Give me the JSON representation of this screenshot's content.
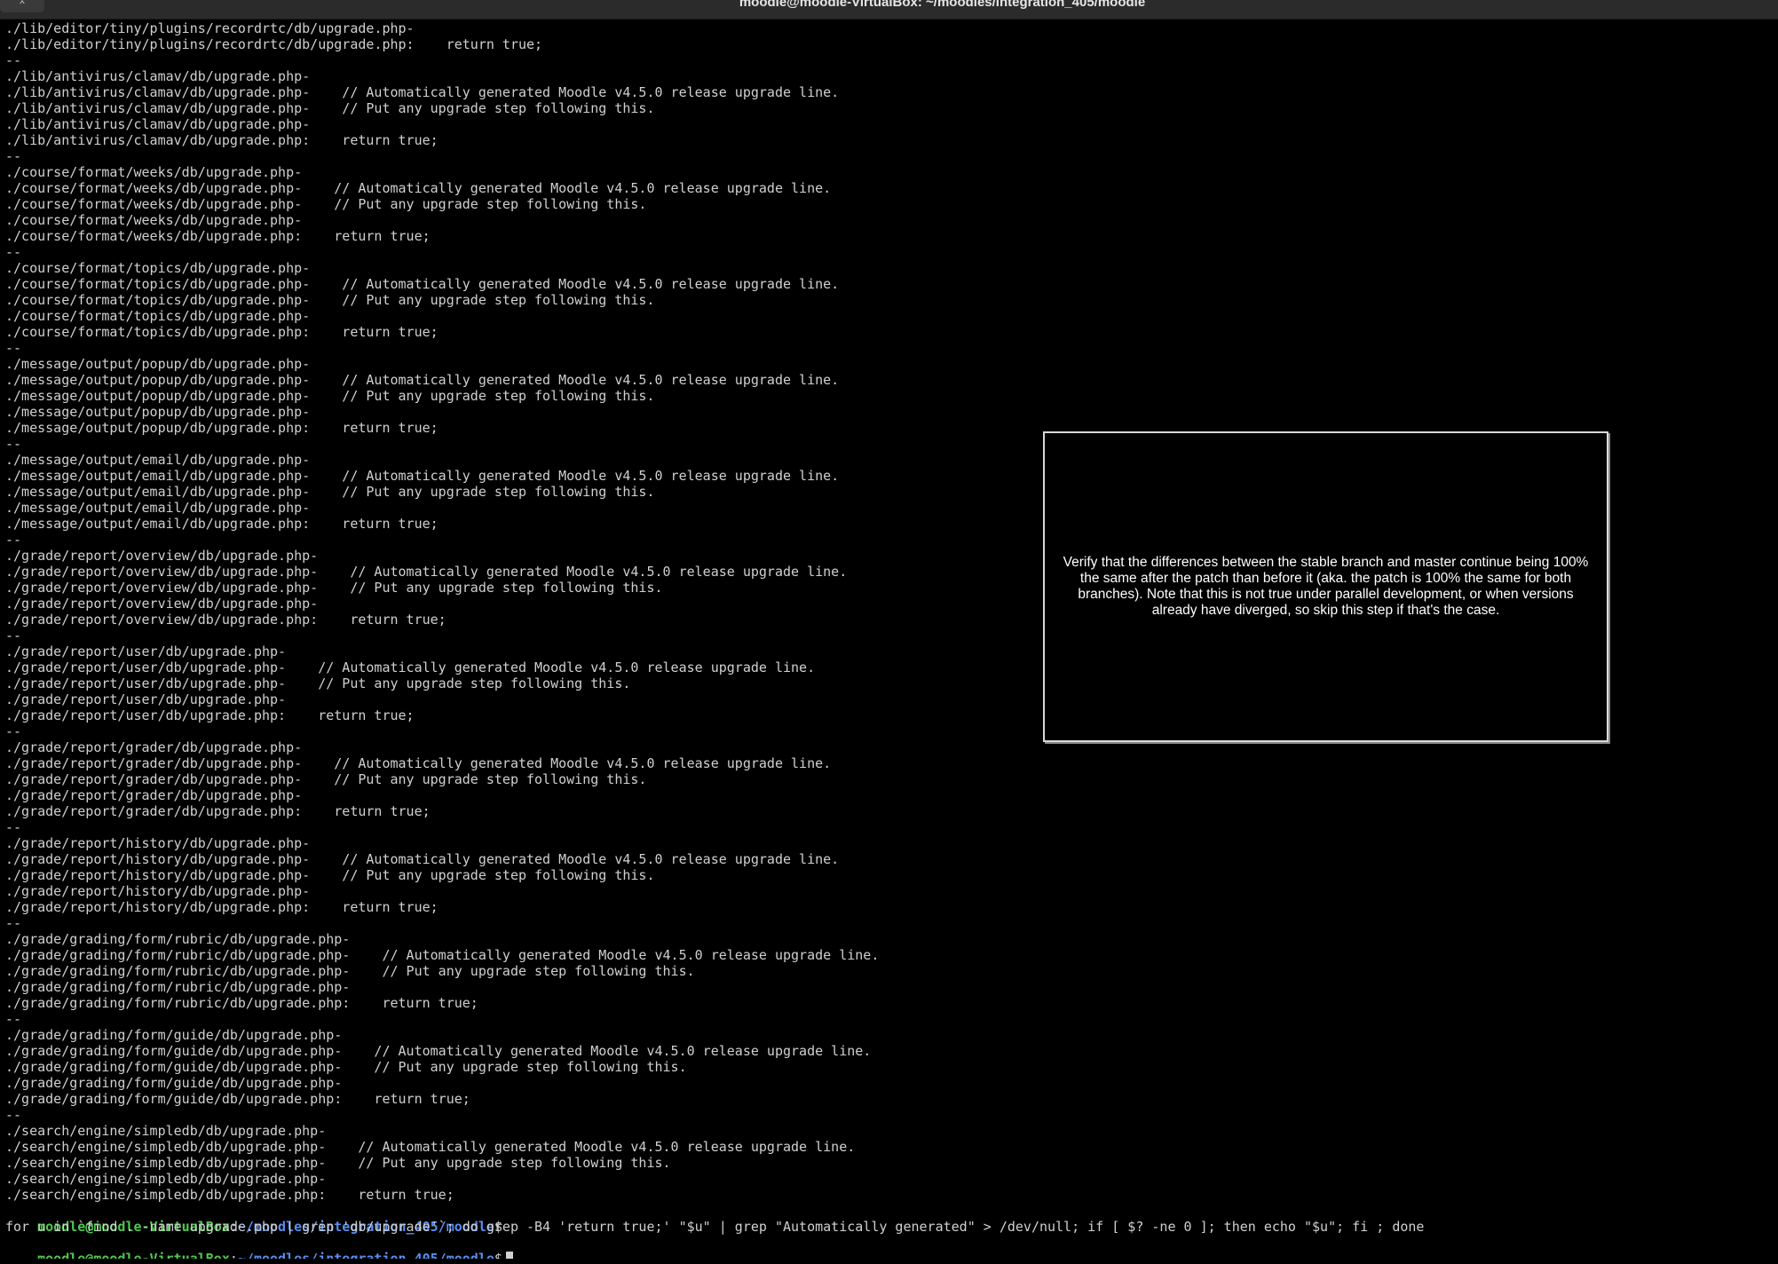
{
  "window": {
    "title": "moodle@moodle-VirtualBox: ~/moodles/integration_405/moodle",
    "menu_glyph": "⌃"
  },
  "terminal": {
    "lines": [
      "./lib/editor/tiny/plugins/recordrtc/db/upgrade.php-",
      "./lib/editor/tiny/plugins/recordrtc/db/upgrade.php:    return true;",
      "--",
      "./lib/antivirus/clamav/db/upgrade.php-",
      "./lib/antivirus/clamav/db/upgrade.php-    // Automatically generated Moodle v4.5.0 release upgrade line.",
      "./lib/antivirus/clamav/db/upgrade.php-    // Put any upgrade step following this.",
      "./lib/antivirus/clamav/db/upgrade.php-",
      "./lib/antivirus/clamav/db/upgrade.php:    return true;",
      "--",
      "./course/format/weeks/db/upgrade.php-",
      "./course/format/weeks/db/upgrade.php-    // Automatically generated Moodle v4.5.0 release upgrade line.",
      "./course/format/weeks/db/upgrade.php-    // Put any upgrade step following this.",
      "./course/format/weeks/db/upgrade.php-",
      "./course/format/weeks/db/upgrade.php:    return true;",
      "--",
      "./course/format/topics/db/upgrade.php-",
      "./course/format/topics/db/upgrade.php-    // Automatically generated Moodle v4.5.0 release upgrade line.",
      "./course/format/topics/db/upgrade.php-    // Put any upgrade step following this.",
      "./course/format/topics/db/upgrade.php-",
      "./course/format/topics/db/upgrade.php:    return true;",
      "--",
      "./message/output/popup/db/upgrade.php-",
      "./message/output/popup/db/upgrade.php-    // Automatically generated Moodle v4.5.0 release upgrade line.",
      "./message/output/popup/db/upgrade.php-    // Put any upgrade step following this.",
      "./message/output/popup/db/upgrade.php-",
      "./message/output/popup/db/upgrade.php:    return true;",
      "--",
      "./message/output/email/db/upgrade.php-",
      "./message/output/email/db/upgrade.php-    // Automatically generated Moodle v4.5.0 release upgrade line.",
      "./message/output/email/db/upgrade.php-    // Put any upgrade step following this.",
      "./message/output/email/db/upgrade.php-",
      "./message/output/email/db/upgrade.php:    return true;",
      "--",
      "./grade/report/overview/db/upgrade.php-",
      "./grade/report/overview/db/upgrade.php-    // Automatically generated Moodle v4.5.0 release upgrade line.",
      "./grade/report/overview/db/upgrade.php-    // Put any upgrade step following this.",
      "./grade/report/overview/db/upgrade.php-",
      "./grade/report/overview/db/upgrade.php:    return true;",
      "--",
      "./grade/report/user/db/upgrade.php-",
      "./grade/report/user/db/upgrade.php-    // Automatically generated Moodle v4.5.0 release upgrade line.",
      "./grade/report/user/db/upgrade.php-    // Put any upgrade step following this.",
      "./grade/report/user/db/upgrade.php-",
      "./grade/report/user/db/upgrade.php:    return true;",
      "--",
      "./grade/report/grader/db/upgrade.php-",
      "./grade/report/grader/db/upgrade.php-    // Automatically generated Moodle v4.5.0 release upgrade line.",
      "./grade/report/grader/db/upgrade.php-    // Put any upgrade step following this.",
      "./grade/report/grader/db/upgrade.php-",
      "./grade/report/grader/db/upgrade.php:    return true;",
      "--",
      "./grade/report/history/db/upgrade.php-",
      "./grade/report/history/db/upgrade.php-    // Automatically generated Moodle v4.5.0 release upgrade line.",
      "./grade/report/history/db/upgrade.php-    // Put any upgrade step following this.",
      "./grade/report/history/db/upgrade.php-",
      "./grade/report/history/db/upgrade.php:    return true;",
      "--",
      "./grade/grading/form/rubric/db/upgrade.php-",
      "./grade/grading/form/rubric/db/upgrade.php-    // Automatically generated Moodle v4.5.0 release upgrade line.",
      "./grade/grading/form/rubric/db/upgrade.php-    // Put any upgrade step following this.",
      "./grade/grading/form/rubric/db/upgrade.php-",
      "./grade/grading/form/rubric/db/upgrade.php:    return true;",
      "--",
      "./grade/grading/form/guide/db/upgrade.php-",
      "./grade/grading/form/guide/db/upgrade.php-    // Automatically generated Moodle v4.5.0 release upgrade line.",
      "./grade/grading/form/guide/db/upgrade.php-    // Put any upgrade step following this.",
      "./grade/grading/form/guide/db/upgrade.php-",
      "./grade/grading/form/guide/db/upgrade.php:    return true;",
      "--",
      "./search/engine/simpledb/db/upgrade.php-",
      "./search/engine/simpledb/db/upgrade.php-    // Automatically generated Moodle v4.5.0 release upgrade line.",
      "./search/engine/simpledb/db/upgrade.php-    // Put any upgrade step following this.",
      "./search/engine/simpledb/db/upgrade.php-",
      "./search/engine/simpledb/db/upgrade.php:    return true;"
    ],
    "prompt_user": "moodle@moodle-VirtualBox",
    "prompt_sep": ":",
    "prompt_path": "~/moodles/integration_405/moodle",
    "prompt_sym": "$",
    "command": "for u in `find . -name upgrade.php | grep 'db/upgrade'`; do grep -B4 'return true;' \"$u\" | grep \"Automatically generated\" > /dev/null; if [ $? -ne 0 ]; then echo \"$u\"; fi ; done"
  },
  "overlay": {
    "text": "Verify that the differences between the stable branch and master continue being 100% the same after the patch than before it (aka. the patch is 100% the same for both branches). Note that this is not true under parallel development, or when versions already have diverged, so skip this step if that's the case."
  },
  "colors": {
    "background": "#000000",
    "text": "#d0d0d0",
    "prompt_user": "#4ec94e",
    "prompt_path": "#5a8ef0"
  }
}
